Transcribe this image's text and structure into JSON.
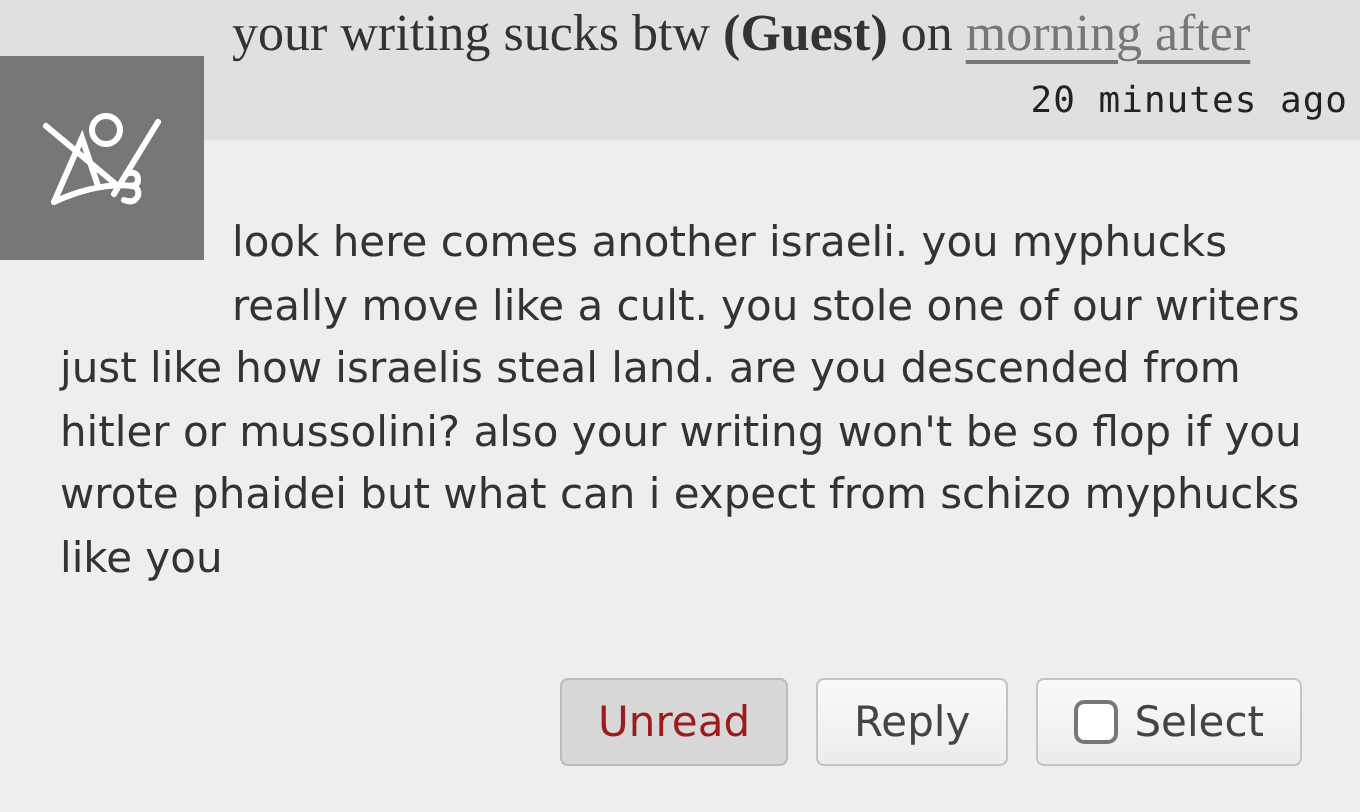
{
  "comment": {
    "author": "your writing sucks btw",
    "author_tag": "(Guest)",
    "on": "on",
    "story_link": "morning after",
    "time": "20 minutes ago",
    "body": "look here comes another israeli. you myphucks really move like a cult. you stole one of our writers just like how israelis steal land. are you descended from hitler or mussolini? also your writing won't be so flop if you wrote phaidei but what can i expect from schizo myphucks like you"
  },
  "buttons": [
    {
      "label": "Unread",
      "kind": "toggle",
      "selected": true
    },
    {
      "label": "Reply",
      "kind": "plain"
    },
    {
      "label": "Select",
      "kind": "checkbox",
      "checked": false
    }
  ]
}
